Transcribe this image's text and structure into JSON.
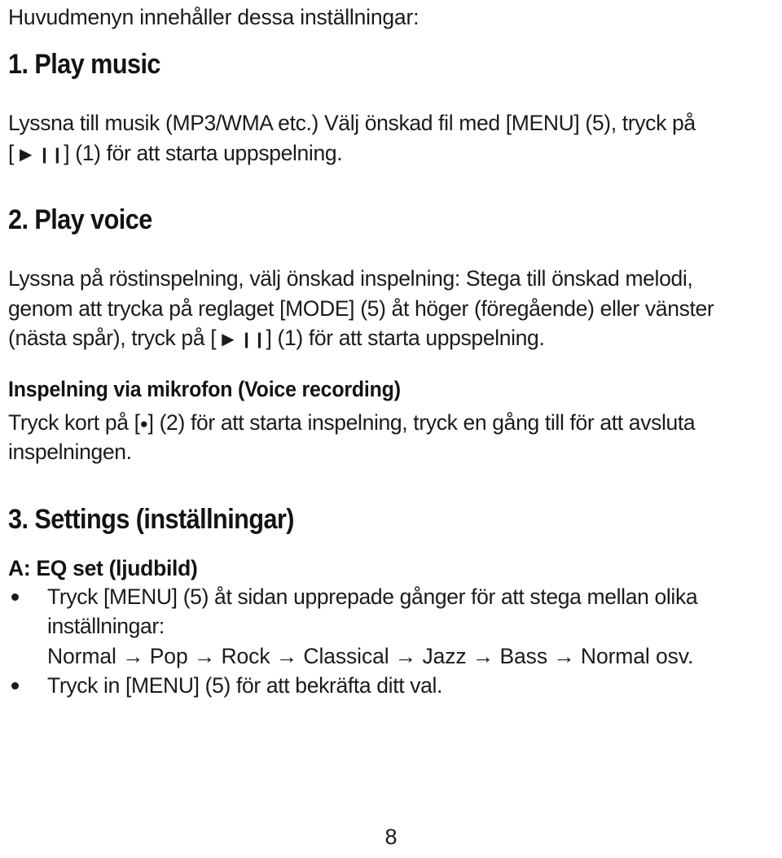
{
  "document": {
    "intro_line": "Huvudmenyn innehåller dessa inställningar:",
    "page_number": "8"
  },
  "sections": [
    {
      "heading": "1. Play music",
      "paragraph_line_1": "Lyssna till musik (MP3/WMA etc.) Välj önskad fil med [MENU] (5), tryck på",
      "paragraph_line_2_prefix": "[",
      "paragraph_line_2_play_glyph": "▶",
      "paragraph_line_2_pause_glyph": "❙❙",
      "paragraph_line_2_suffix": "] (1) för att starta uppspelning."
    },
    {
      "heading": "2. Play voice",
      "paragraph_line_1": "Lyssna på röstinspelning, välj önskad inspelning: Stega till önskad melodi,",
      "paragraph_line_2": "genom att trycka på reglaget [MODE] (5) åt höger (föregående) eller vänster",
      "paragraph_line_3_prefix": "(nästa spår), tryck på [",
      "paragraph_line_3_play_glyph": "▶",
      "paragraph_line_3_pause_glyph": "❙❙",
      "paragraph_line_3_suffix": "] (1) för att starta uppspelning."
    }
  ],
  "voice_recording": {
    "heading": "Inspelning via mikrofon (Voice recording)",
    "line_1_prefix": "Tryck kort på [",
    "line_1_rec_glyph": "●",
    "line_1_suffix": "] (2) för att starta inspelning, tryck en gång till för att avsluta",
    "line_2": "inspelningen."
  },
  "settings": {
    "heading": "3. Settings (inställningar)",
    "eq": {
      "label": "A: EQ set (ljudbild)",
      "bullets": [
        {
          "line_1": "Tryck [MENU] (5) åt sidan upprepade gånger för att stega mellan olika",
          "line_2": "inställningar:",
          "line_3": "Normal → Pop → Rock → Classical → Jazz → Bass  → Normal osv."
        },
        {
          "line_1": "Tryck in [MENU] (5) för att bekräfta ditt val."
        }
      ]
    }
  }
}
